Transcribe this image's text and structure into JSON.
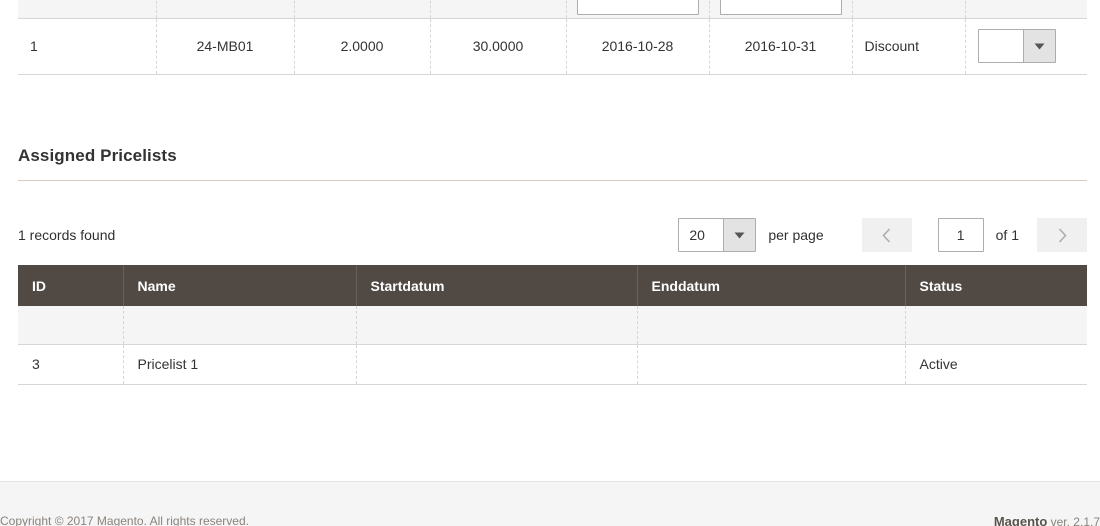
{
  "top_grid": {
    "filter_row": {
      "cells": [
        {
          "type": "blank"
        },
        {
          "type": "blank"
        },
        {
          "type": "blank"
        },
        {
          "type": "blank"
        },
        {
          "type": "input",
          "value": "",
          "placeholder": ""
        },
        {
          "type": "input",
          "value": "",
          "placeholder": ""
        },
        {
          "type": "blank"
        },
        {
          "type": "blank"
        }
      ]
    },
    "data_row": {
      "id": "1",
      "sku": "24-MB01",
      "qty": "2.0000",
      "price": "30.0000",
      "start_date": "2016-10-28",
      "end_date": "2016-10-31",
      "type": "Discount",
      "action_select": {
        "value": "",
        "arrow_icon": "chevron-down-icon"
      }
    }
  },
  "section": {
    "title": "Assigned Pricelists"
  },
  "toolbar": {
    "records_found": "1 records found",
    "per_page": {
      "value": "20",
      "label": "per page",
      "arrow_icon": "chevron-down-icon"
    },
    "pagination": {
      "previous_icon": "chevron-left-icon",
      "next_icon": "chevron-right-icon",
      "current_page": "1",
      "of_total": "of 1"
    }
  },
  "pricelist_grid": {
    "columns": [
      "ID",
      "Name",
      "Startdatum",
      "Enddatum",
      "Status"
    ],
    "filter_row": [
      "",
      "",
      "",
      "",
      ""
    ],
    "rows": [
      {
        "id": "3",
        "name": "Pricelist 1",
        "startdatum": "",
        "enddatum": "",
        "status": "Active"
      }
    ]
  },
  "footer": {
    "copyright": "Copyright © 2017 Magento. All rights reserved.",
    "brand": "Magento",
    "version": " ver. 2.1.7"
  },
  "colors": {
    "grid_header_bg": "#514943",
    "filter_row_bg": "#f5f5f5",
    "page_bg": "#ffffff",
    "footer_bg": "#f5f5f5",
    "text": "#333333",
    "rule": "#d6ccc2"
  }
}
